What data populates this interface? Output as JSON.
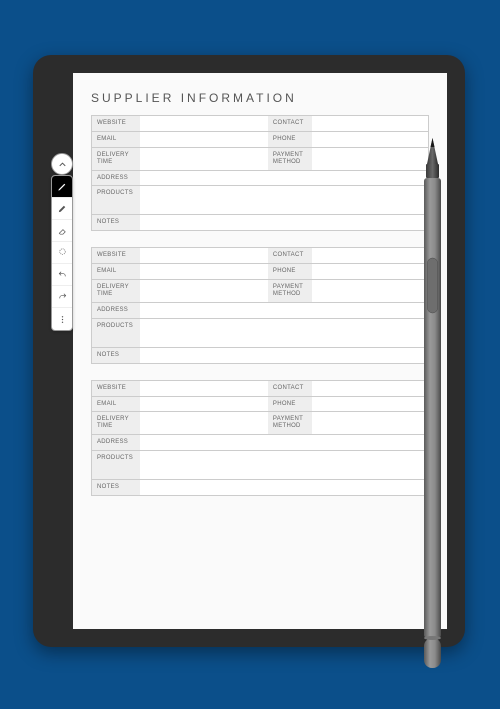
{
  "title": "SUPPLIER INFORMATION",
  "labels": {
    "website": "WEBSITE",
    "contact": "CONTACT",
    "email": "EMAIL",
    "phone": "PHONE",
    "delivery_time": "DELIVERY\nTIME",
    "payment_method": "PAYMENT\nMETHOD",
    "address": "ADDRESS",
    "products": "PRODUCTS",
    "notes": "NOTES"
  },
  "blocks": [
    {
      "website": "",
      "contact": "",
      "email": "",
      "phone": "",
      "delivery_time": "",
      "payment_method": "",
      "address": "",
      "products": "",
      "notes": ""
    },
    {
      "website": "",
      "contact": "",
      "email": "",
      "phone": "",
      "delivery_time": "",
      "payment_method": "",
      "address": "",
      "products": "",
      "notes": ""
    },
    {
      "website": "",
      "contact": "",
      "email": "",
      "phone": "",
      "delivery_time": "",
      "payment_method": "",
      "address": "",
      "products": "",
      "notes": ""
    }
  ],
  "toolbar": {
    "collapse": "chevron-up",
    "tools": [
      "pen",
      "marker",
      "eraser",
      "lasso",
      "undo",
      "redo",
      "more"
    ]
  }
}
